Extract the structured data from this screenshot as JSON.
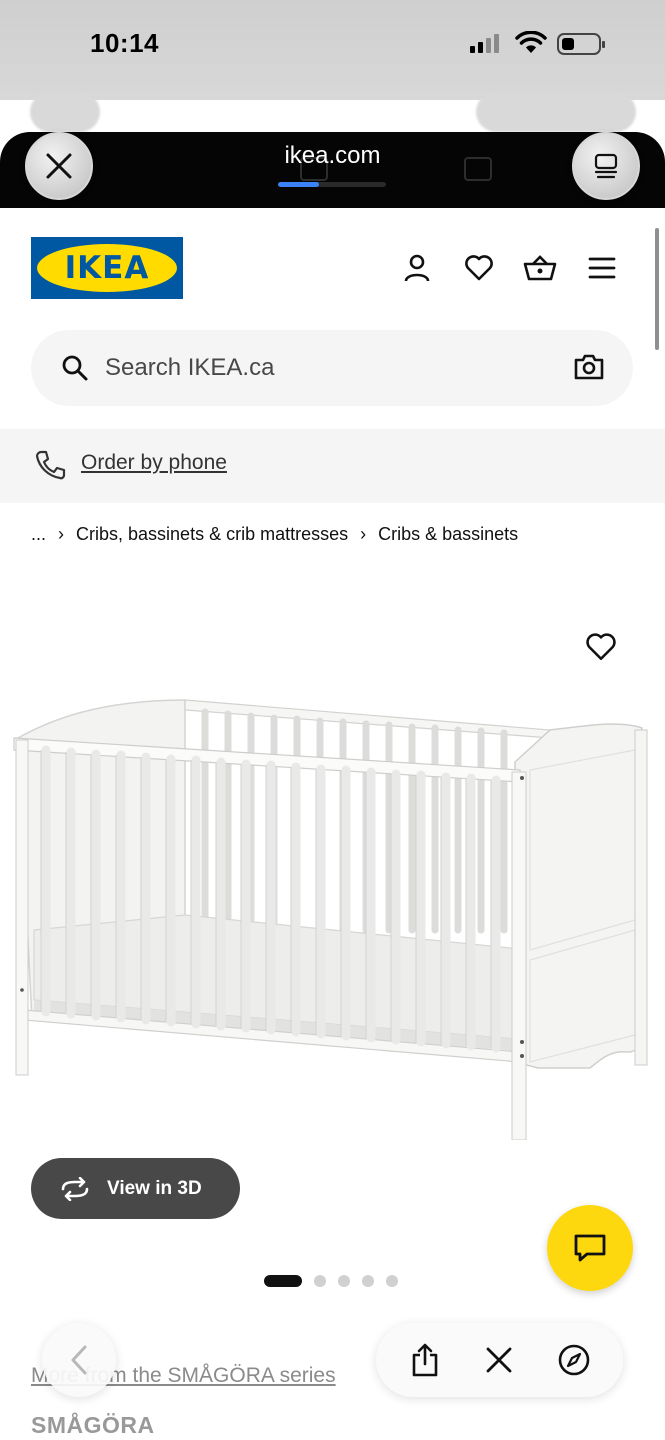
{
  "status_bar": {
    "time": "10:14"
  },
  "browser": {
    "url": "ikea.com",
    "load_progress": 0.38
  },
  "header": {
    "logo_text": "IKEA",
    "icons": [
      "account-icon",
      "heart-icon",
      "cart-icon",
      "menu-icon"
    ]
  },
  "search": {
    "placeholder": "Search IKEA.ca"
  },
  "order_by_phone": {
    "label": "Order by phone"
  },
  "breadcrumb": {
    "ellipsis": "...",
    "items": [
      "Cribs, bassinets & crib mattresses",
      "Cribs & bassinets"
    ]
  },
  "product": {
    "view3d_label": "View in 3D",
    "image_count": 5,
    "active_image": 1,
    "series_link": "More from the SMÅGÖRA series",
    "name": "SMÅGÖRA"
  },
  "colors": {
    "ikea_blue": "#0058a3",
    "ikea_yellow": "#ffdb00",
    "chat_yellow": "#fdd80f",
    "progress_blue": "#3b82f6",
    "view3d_bg": "#484848"
  }
}
